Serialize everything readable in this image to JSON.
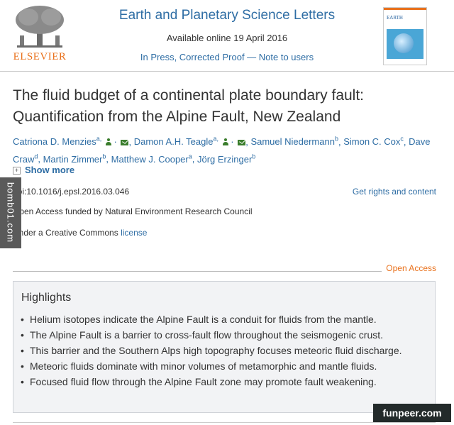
{
  "header": {
    "publisher_logo_text": "ELSEVIER",
    "journal_title": "Earth and Planetary Science Letters",
    "available_online": "Available online 19 April 2016",
    "in_press_line": "In Press, Corrected Proof — Note to users",
    "cover_title": "EARTH"
  },
  "article": {
    "title": "The fluid budget of a continental plate boundary fault: Quantification from the Alpine Fault, New Zealand",
    "authors": [
      {
        "name": "Catriona D. Menzies",
        "sup": "a,",
        "icons": true
      },
      {
        "name": "Damon A.H. Teagle",
        "sup": "a,",
        "icons": true
      },
      {
        "name": "Samuel Niedermann",
        "sup": "b",
        "icons": false
      },
      {
        "name": "Simon C. Cox",
        "sup": "c",
        "icons": false
      },
      {
        "name": "Dave Craw",
        "sup": "d",
        "icons": false
      },
      {
        "name": "Martin Zimmer",
        "sup": "b",
        "icons": false
      },
      {
        "name": "Matthew J. Cooper",
        "sup": "a",
        "icons": false
      },
      {
        "name": "Jörg Erzinger",
        "sup": "b",
        "icons": false
      }
    ],
    "show_more": "Show more",
    "show_more_plus": "+",
    "doi": "doi:10.1016/j.epsl.2016.03.046",
    "rights_link": "Get rights and content",
    "funding": "Open Access funded by Natural Environment Research Council",
    "license_prefix": "Under a Creative Commons ",
    "license_link": "license",
    "open_access_label": "Open Access"
  },
  "highlights": {
    "title": "Highlights",
    "items": [
      "Helium isotopes indicate the Alpine Fault is a conduit for fluids from the mantle.",
      "The Alpine Fault is a barrier to cross-fault flow throughout the seismogenic crust.",
      "This barrier and the Southern Alps high topography focuses meteoric fluid discharge.",
      "Meteoric fluids dominate with minor volumes of metamorphic and mantle fluids.",
      "Focused fluid flow through the Alpine Fault zone may promote fault weakening."
    ]
  },
  "watermarks": {
    "left": "bomb01.com",
    "bottom_right": "funpeer.com"
  },
  "colors": {
    "link": "#2e6da4",
    "accent_orange": "#e9711c",
    "icon_green": "#3a7d2c"
  }
}
